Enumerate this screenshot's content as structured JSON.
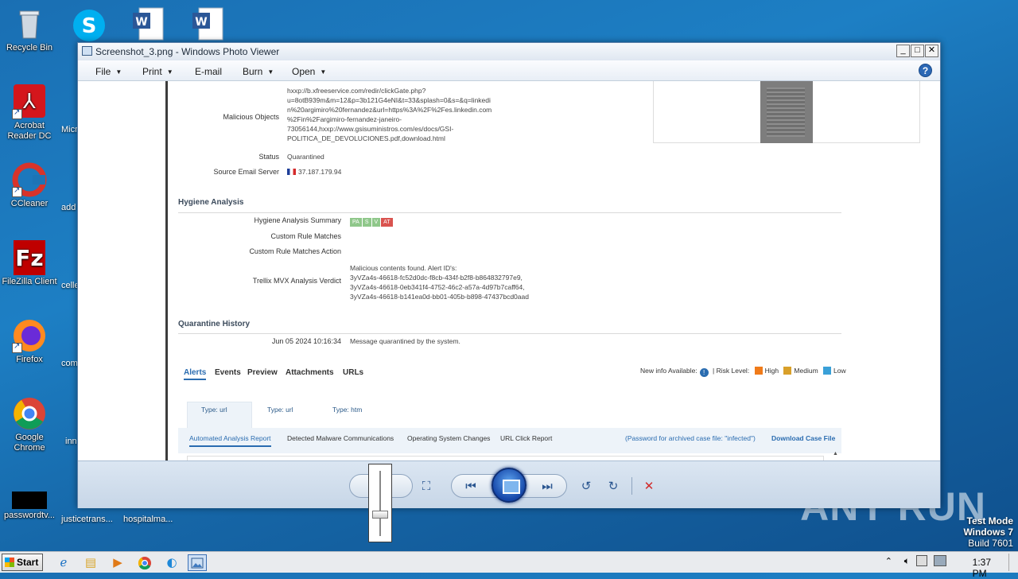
{
  "desktop": {
    "icons": [
      {
        "label": "Recycle Bin"
      },
      {
        "label": "Acrobat Reader DC"
      },
      {
        "label": "CCleaner"
      },
      {
        "label": "FileZilla Client"
      },
      {
        "label": "Firefox"
      },
      {
        "label": "Google Chrome"
      },
      {
        "label": "passwordtv..."
      }
    ],
    "cut_labels": [
      "Micr",
      "add",
      "celle",
      "com",
      "inn",
      "justicetrans...",
      "hospitalma..."
    ],
    "watermark": "ANY RUN",
    "test_mode": {
      "line1": "Test Mode",
      "line2": "Windows 7",
      "line3": "Build 7601"
    }
  },
  "window": {
    "title": "Screenshot_3.png - Windows Photo Viewer",
    "controls": {
      "minimize": "_",
      "maximize": "□",
      "close": "✕"
    },
    "menu": [
      {
        "label": "File",
        "has_arrow": true
      },
      {
        "label": "Print",
        "has_arrow": true
      },
      {
        "label": "E-mail",
        "has_arrow": false
      },
      {
        "label": "Burn",
        "has_arrow": true
      },
      {
        "label": "Open",
        "has_arrow": true
      }
    ],
    "help": "?"
  },
  "report": {
    "malicious_objects": {
      "label": "Malicious Objects",
      "lines": [
        "hxxp://b.xfreeservice.com/redir/clickGate.php?",
        "u=8otB939m&m=12&p=3b121G4eNI&t=33&splash=0&s=&q=linkedi",
        "n%20argimiro%20fernandez&url=https%3A%2F%2Fes.linkedin.com",
        "%2Fin%2Fargimiro-fernandez-janeiro-",
        "73056144,hxxp://www.gsisuministros.com/es/docs/GSI-",
        "POLITICA_DE_DEVOLUCIONES.pdf,download.html"
      ]
    },
    "status": {
      "label": "Status",
      "value": "Quarantined"
    },
    "source_server": {
      "label": "Source Email Server",
      "value": "37.187.179.94"
    },
    "hygiene": {
      "title": "Hygiene Analysis",
      "summary_label": "Hygiene Analysis Summary",
      "pills": [
        {
          "text": "PA",
          "color": "#8fc78a"
        },
        {
          "text": "S",
          "color": "#8fc78a"
        },
        {
          "text": "V",
          "color": "#8fc78a"
        },
        {
          "text": "AT",
          "color": "#d9534f"
        }
      ],
      "custom_rule_matches": "Custom Rule Matches",
      "custom_rule_action": "Custom Rule Matches Action",
      "verdict_label": "Trellix MVX Analysis Verdict",
      "verdict_lines": [
        "Malicious contents found. Alert ID's:",
        "3yVZa4s-46618-fc52d0dc-f8cb-434f-b2f8-b864832797e9,",
        "3yVZa4s-46618-0eb341f4-4752-46c2-a57a-4d97b7caff64,",
        "3yVZa4s-46618-b141ea0d-bb01-405b-b898-47437bcd0aad"
      ]
    },
    "quarantine": {
      "title": "Quarantine History",
      "date": "Jun 05 2024 10:16:34",
      "message": "Message quarantined by the system."
    },
    "tabs": [
      "Alerts",
      "Events",
      "Preview",
      "Attachments",
      "URLs"
    ],
    "legend": {
      "new_info": "New info Available:",
      "risk": "| Risk Level:",
      "levels": [
        {
          "label": "High",
          "color": "#f07b1a"
        },
        {
          "label": "Medium",
          "color": "#d9a02a"
        },
        {
          "label": "Low",
          "color": "#3aa0d8"
        }
      ]
    },
    "type_tabs": [
      "Type: url",
      "Type: url",
      "Type: htm"
    ],
    "sub_tabs": [
      "Automated Analysis Report",
      "Detected Malware Communications",
      "Operating System Changes",
      "URL Click Report"
    ],
    "password_note": "(Password for archived case file: \"infected\")",
    "download_link": "Download Case File"
  },
  "taskbar": {
    "start": "Start",
    "time": "1:37 PM",
    "accent": "#3b6fb5"
  }
}
